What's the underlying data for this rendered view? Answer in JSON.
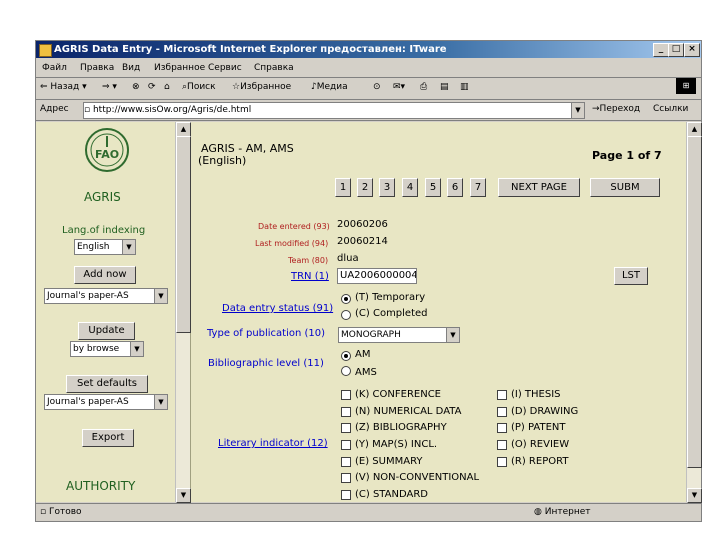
{
  "window": {
    "title": "AGRIS Data Entry - Microsoft Internet Explorer предоставлен: ITware"
  },
  "menu": [
    "Файл",
    "Правка",
    "Вид",
    "Избранное",
    "Сервис",
    "Справка"
  ],
  "toolbar": {
    "back": "Назад",
    "search": "Поиск",
    "favorites": "Избранное",
    "media": "Медиа"
  },
  "address": {
    "label": "Адрес",
    "url": "http://www.sisOw.org/Agris/de.html",
    "go": "Переход",
    "links": "Ссылки"
  },
  "left": {
    "logo": "FAO",
    "agris": "AGRIS",
    "lang_label": "Lang.of indexing",
    "lang_value": "English",
    "add_now": "Add now",
    "journal1": "Journal's paper-AS",
    "update": "Update",
    "by_browse": "by browse",
    "set_defaults": "Set defaults",
    "journal2": "Journal's paper-AS",
    "export": "Export",
    "authority": "AUTHORITY"
  },
  "main": {
    "heading": "AGRIS - AM, AMS",
    "heading_lang": "(English)",
    "page_info": "Page 1 of 7",
    "pages": [
      "1",
      "2",
      "3",
      "4",
      "5",
      "6",
      "7"
    ],
    "next_page": "NEXT PAGE",
    "submit": "SUBM",
    "date_entered_label": "Date entered (93)",
    "date_entered_value": "20060206",
    "last_modified_label": "Last modified (94)",
    "last_modified_value": "20060214",
    "team_label": "Team (80)",
    "team_value": "dlua",
    "trn_label": "TRN (1)",
    "trn_value": "UA2006000004",
    "lst": "LST",
    "status_label": "Data entry status (91)",
    "status_opts": [
      "(T) Temporary",
      "(C) Completed"
    ],
    "pubtype_label": "Type of publication (10)",
    "pubtype_value": "MONOGRAPH",
    "biblevel_label": "Bibliographic level (11)",
    "biblevel_opts": [
      "AM",
      "AMS"
    ],
    "literary_label": "Literary indicator (12)",
    "literary_col1": [
      "(K) CONFERENCE",
      "(N) NUMERICAL DATA",
      "(Z) BIBLIOGRAPHY",
      "(Y) MAP(S) INCL.",
      "(E) SUMMARY",
      "(V) NON-CONVENTIONAL",
      "(C) STANDARD"
    ],
    "literary_col2": [
      "(I) THESIS",
      "(D) DRAWING",
      "(P) PATENT",
      "(O) REVIEW",
      "(R) REPORT"
    ]
  },
  "status": {
    "left": "Готово",
    "zone": "Интернет"
  }
}
